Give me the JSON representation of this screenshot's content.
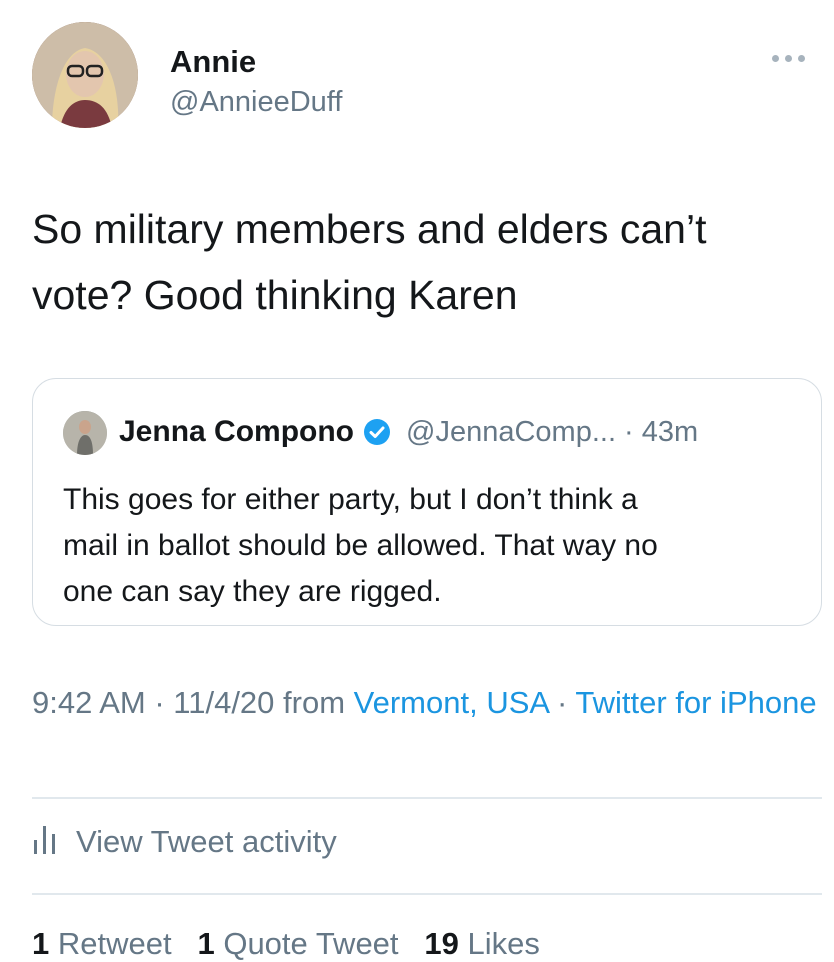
{
  "author": {
    "name": "Annie",
    "handle": "@AnnieeDuff"
  },
  "tweet": {
    "text_line1": "So military members and elders can’t",
    "text_line2": "vote? Good thinking Karen"
  },
  "quoted_tweet": {
    "name": "Jenna Compono",
    "handle_time": "@JennaComp... · 43m",
    "text_line1": "This goes for either party, but I don’t think a",
    "text_line2": "mail in ballot should be allowed. That way no",
    "text_line3": "one can say they are rigged."
  },
  "meta": {
    "time_date": "9:42 AM · 11/4/20 from ",
    "location": "Vermont, USA",
    "separator": " · ",
    "source": "Twitter for iPhone"
  },
  "activity": {
    "label": "View Tweet activity"
  },
  "stats": {
    "retweets_count": "1",
    "retweets_label": "Retweet",
    "quotes_count": "1",
    "quotes_label": "Quote Tweet",
    "likes_count": "19",
    "likes_label": "Likes"
  },
  "colors": {
    "link": "#1b95e0",
    "secondary_text": "#657786",
    "primary_text": "#14171a",
    "border": "#d6dde3"
  },
  "icons": {
    "more": "more-dots-icon",
    "verified": "verified-badge-icon",
    "activity": "bar-chart-icon"
  }
}
